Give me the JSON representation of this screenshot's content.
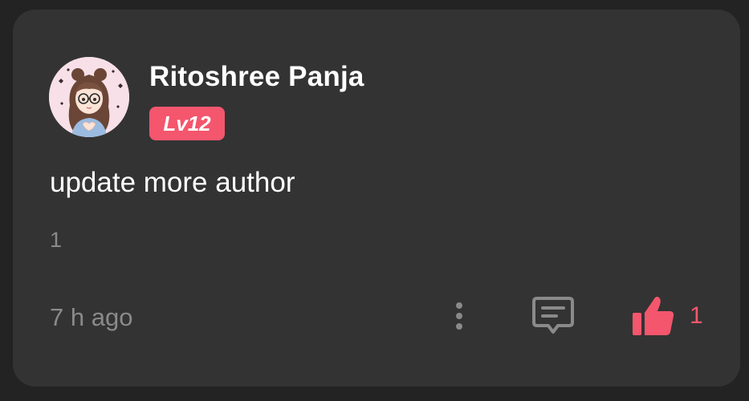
{
  "comment": {
    "user": {
      "name": "Ritoshree Panja",
      "level": "Lv12",
      "avatar_icon": "anime-girl-avatar"
    },
    "text": "update more author",
    "reply_count": "1",
    "timestamp": "7 h ago",
    "like_count": "1"
  },
  "icons": {
    "more": "more-vertical-icon",
    "reply": "comment-icon",
    "like": "thumbs-up-icon"
  },
  "colors": {
    "card_background": "#333333",
    "page_background": "#232323",
    "accent": "#f4566d",
    "muted_text": "#8a8a8a",
    "primary_text": "#ffffff"
  }
}
